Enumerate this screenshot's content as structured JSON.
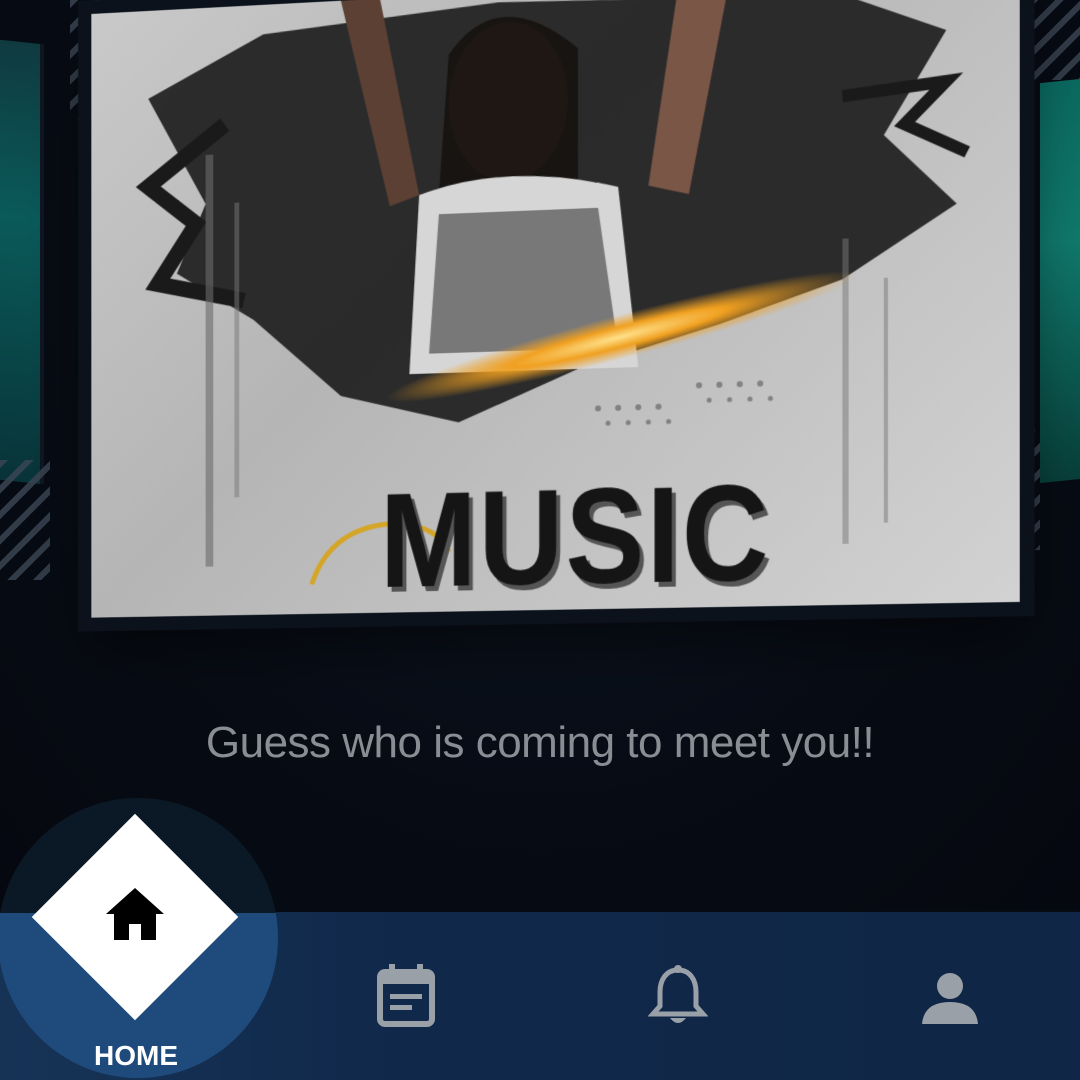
{
  "poster": {
    "title": "MUSIC"
  },
  "tagline": "Guess who is coming to meet you!!",
  "bottom_nav": {
    "items": [
      {
        "label": "HOME",
        "icon": "home-icon",
        "active": true
      },
      {
        "label": "",
        "icon": "calendar-icon",
        "active": false
      },
      {
        "label": "",
        "icon": "bell-icon",
        "active": false
      },
      {
        "label": "",
        "icon": "profile-icon",
        "active": false
      }
    ]
  },
  "colors": {
    "background": "#060a13",
    "nav_bar": "#163356",
    "active_circle": "#1e4a7c",
    "icon_inactive": "#9aa0a8",
    "tagline": "#8a8d93"
  }
}
